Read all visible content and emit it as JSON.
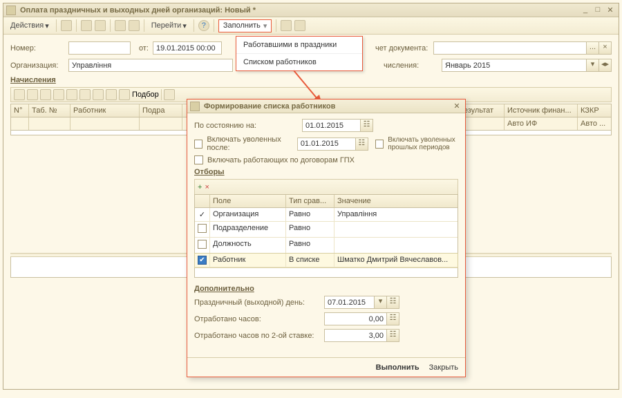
{
  "window": {
    "title": "Оплата праздничных и выходных дней организаций: Новый *"
  },
  "toolbar": {
    "actions": "Действия",
    "goto": "Перейти",
    "fill": "Заполнить"
  },
  "fillMenu": {
    "opt1": "Работавшими в праздники",
    "opt2": "Списком работников"
  },
  "form": {
    "number_label": "Номер:",
    "from_label": "от:",
    "from_value": "19.01.2015 00:00",
    "accounting_label": "чет документа:",
    "org_label": "Организация:",
    "org_value": "Управління",
    "accrual_month_label": "числения:",
    "accrual_month_value": "Январь 2015",
    "section": "Начисления",
    "podbor": "Подбор"
  },
  "grid": {
    "c1": "N°",
    "c2": "Таб. №",
    "c3": "Работник",
    "c4": "Подра",
    "c5": "Результат",
    "c6": "Источник финан...",
    "c7": "КЗКР",
    "r1c6": "Авто ИФ",
    "r1c7": "Авто ..."
  },
  "modal": {
    "title": "Формирование списка работников",
    "asof_label": "По состоянию на:",
    "asof_value": "01.01.2015",
    "incl_fired_label": "Включать уволенных после:",
    "incl_fired_value": "01.01.2015",
    "incl_past_label": "Включать уволенных прошлых периодов",
    "incl_gpx_label": "Включать работающих по договорам ГПХ",
    "filters_h": "Отборы",
    "col_field": "Поле",
    "col_cmp": "Тип срав...",
    "col_val": "Значение",
    "rows": [
      {
        "chk": "✓",
        "field": "Организация",
        "cmp": "Равно",
        "val": "Управління"
      },
      {
        "chk": "",
        "field": "Подразделение",
        "cmp": "Равно",
        "val": ""
      },
      {
        "chk": "",
        "field": "Должность",
        "cmp": "Равно",
        "val": ""
      },
      {
        "chk": "✔",
        "field": "Работник",
        "cmp": "В списке",
        "val": "Шматко Дмитрий Вячеславов..."
      }
    ],
    "extra_h": "Дополнительно",
    "holiday_label": "Праздничный (выходной) день:",
    "holiday_value": "07.01.2015",
    "hours_label": "Отработано часов:",
    "hours_value": "0,00",
    "hours2_label": "Отработано часов по 2-ой ставке:",
    "hours2_value": "3,00",
    "ok": "Выполнить",
    "close": "Закрыть"
  }
}
